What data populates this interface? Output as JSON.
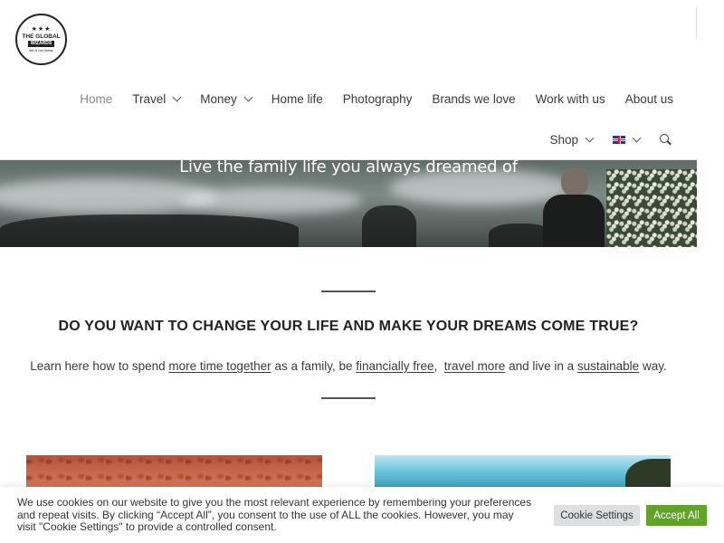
{
  "brand": {
    "logo_line1": "THE GLOBAL",
    "logo_line2": "WIZARDS",
    "logo_tagline": "life is not linear"
  },
  "nav": {
    "row1": [
      {
        "label": "Home",
        "active": true,
        "dropdown": false
      },
      {
        "label": "Travel",
        "active": false,
        "dropdown": true
      },
      {
        "label": "Money",
        "active": false,
        "dropdown": true
      },
      {
        "label": "Home life",
        "active": false,
        "dropdown": false
      },
      {
        "label": "Photography",
        "active": false,
        "dropdown": false
      },
      {
        "label": "Brands we love",
        "active": false,
        "dropdown": false
      },
      {
        "label": "Work with us",
        "active": false,
        "dropdown": false
      },
      {
        "label": "About us",
        "active": false,
        "dropdown": false
      }
    ],
    "row2": {
      "shop_label": "Shop",
      "language_icon": "uk-flag-icon",
      "search_icon": "search-icon"
    }
  },
  "hero": {
    "title": "Live the family life you always dreamed of"
  },
  "content": {
    "headline": "DO YOU WANT TO CHANGE YOUR LIFE AND MAKE YOUR DREAMS COME TRUE?",
    "intro_prefix": "Learn here how to spend ",
    "link_time": "more time together",
    "intro_mid1": " as a family, be ",
    "link_financial": "financially free",
    "intro_mid2": ",  ",
    "link_travel": "travel more",
    "intro_mid3": " and live in a ",
    "link_sustainable": "sustainable",
    "intro_suffix": " way."
  },
  "cookie": {
    "text": "We use cookies on our website to give you the most relevant experience by remembering your preferences and repeat visits. By clicking “Accept All”, you consent to the use of ALL the cookies. However, you may visit \"Cookie Settings\" to provide a controlled consent.",
    "settings_label": "Cookie Settings",
    "accept_label": "Accept All"
  },
  "colors": {
    "accept_green": "#61a229",
    "settings_grey": "#dedfe0",
    "text": "#3a3a3a"
  }
}
